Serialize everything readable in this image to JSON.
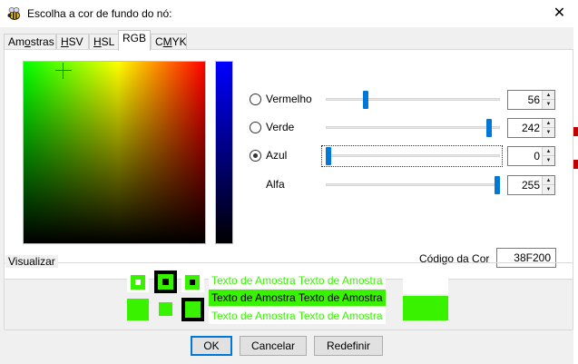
{
  "window": {
    "title": "Escolha a cor de fundo do nó:",
    "close_glyph": "✕",
    "app_icon": "bee-icon"
  },
  "tabs": [
    {
      "label": "Amostras",
      "active": false
    },
    {
      "label": "HSV",
      "active": false
    },
    {
      "label": "HSL",
      "active": false
    },
    {
      "label": "RGB",
      "active": true
    },
    {
      "label": "CMYK",
      "active": false
    }
  ],
  "channels": [
    {
      "key": "red",
      "label": "Vermelho",
      "value": "56",
      "fraction": 0.22,
      "radio": true,
      "checked": false
    },
    {
      "key": "green",
      "label": "Verde",
      "value": "242",
      "fraction": 0.95,
      "radio": true,
      "checked": false
    },
    {
      "key": "blue",
      "label": "Azul",
      "value": "0",
      "fraction": 0.0,
      "radio": true,
      "checked": true
    },
    {
      "key": "alpha",
      "label": "Alfa",
      "value": "255",
      "fraction": 1.0,
      "radio": false,
      "checked": false
    }
  ],
  "picker": {
    "crosshair_fraction_x": 0.22,
    "crosshair_fraction_y": 0.05
  },
  "hex": {
    "label": "Código da Cor",
    "value": "38F200"
  },
  "preview": {
    "legend": "Visualizar",
    "sample_text": "Texto de Amostra Texto de Amostra",
    "color": "#38f200"
  },
  "buttons": {
    "ok": "OK",
    "cancel": "Cancelar",
    "reset": "Redefinir"
  }
}
